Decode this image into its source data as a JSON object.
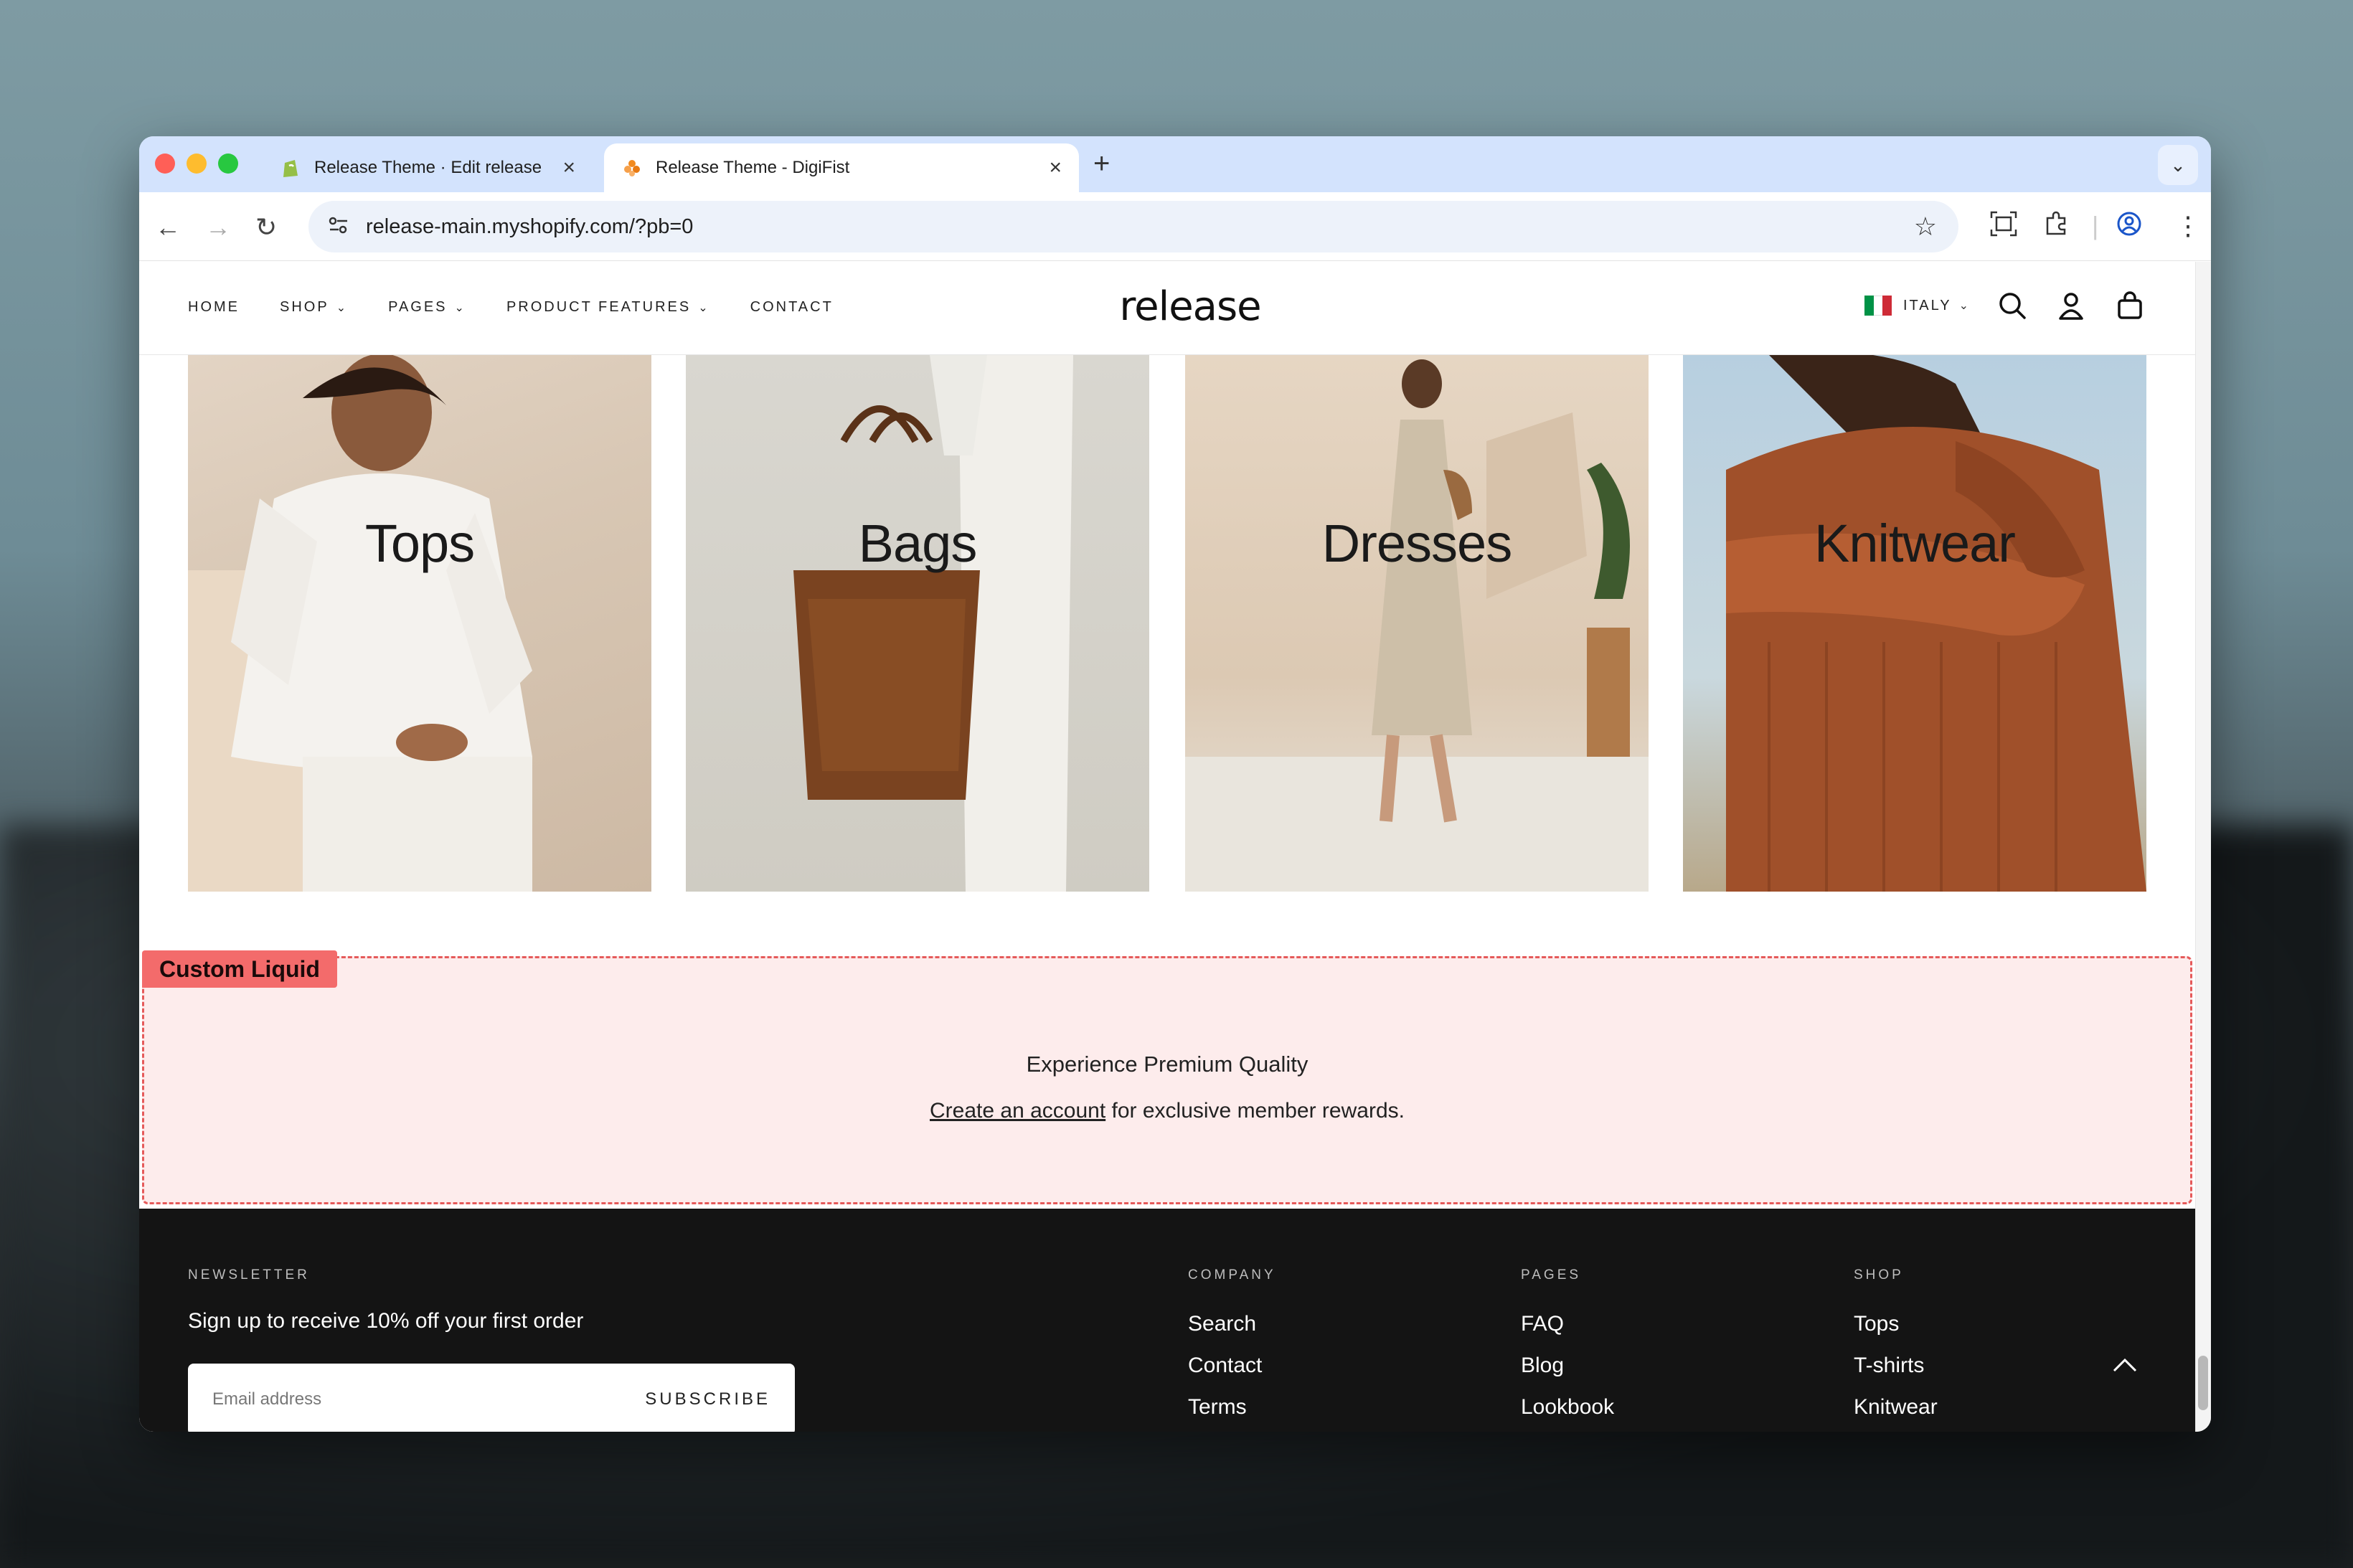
{
  "browser": {
    "tabs": [
      {
        "title": "Release Theme · Edit release",
        "favicon": "shopify-icon"
      },
      {
        "title": "Release Theme - DigiFist",
        "favicon": "digifist-icon",
        "active": true
      }
    ],
    "url": "release-main.myshopify.com/?pb=0"
  },
  "site": {
    "logo": "release",
    "nav": [
      {
        "label": "HOME",
        "dropdown": false
      },
      {
        "label": "SHOP",
        "dropdown": true
      },
      {
        "label": "PAGES",
        "dropdown": true
      },
      {
        "label": "PRODUCT FEATURES",
        "dropdown": true
      },
      {
        "label": "CONTACT",
        "dropdown": false
      }
    ],
    "country": "ITALY",
    "flag_colors": [
      "#009246",
      "#ffffff",
      "#ce2b37"
    ]
  },
  "collections": [
    {
      "label": "Tops"
    },
    {
      "label": "Bags"
    },
    {
      "label": "Dresses"
    },
    {
      "label": "Knitwear"
    }
  ],
  "custom_liquid": {
    "tag": "Custom Liquid",
    "heading": "Experience Premium Quality",
    "link_text": "Create an account",
    "rest_text": " for exclusive member rewards."
  },
  "footer": {
    "newsletter": {
      "heading": "NEWSLETTER",
      "text": "Sign up to receive 10% off your first order",
      "placeholder": "Email address",
      "button": "SUBSCRIBE"
    },
    "columns": [
      {
        "heading": "COMPANY",
        "links": [
          "Search",
          "Contact",
          "Terms"
        ]
      },
      {
        "heading": "PAGES",
        "links": [
          "FAQ",
          "Blog",
          "Lookbook"
        ]
      },
      {
        "heading": "SHOP",
        "links": [
          "Tops",
          "T-shirts",
          "Knitwear"
        ]
      }
    ]
  }
}
